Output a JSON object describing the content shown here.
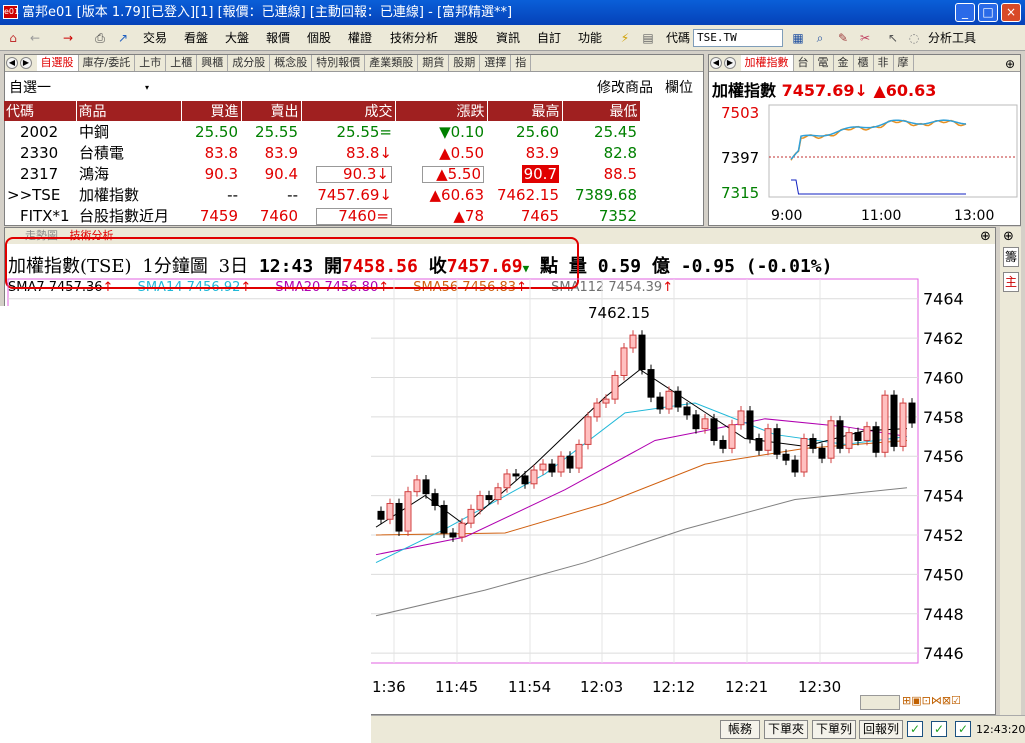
{
  "window": {
    "title": "富邦e01 [版本 1.79][已登入][1] [報價：已連線] [主動回報：已連線] - [富邦精選**]",
    "icon_text": "e01",
    "min": "_",
    "max": "□",
    "close": "×"
  },
  "toolbar": {
    "menus": [
      "交易",
      "看盤",
      "大盤",
      "報價",
      "個股",
      "權證",
      "技術分析",
      "選股",
      "資訊",
      "自訂",
      "功能"
    ],
    "code_label": "代碼",
    "code_value": "TSE.TW",
    "tools_label": "分析工具"
  },
  "watchlist": {
    "tabs": [
      "自選股",
      "庫存/委託",
      "上市",
      "上櫃",
      "興櫃",
      "成分股",
      "概念股",
      "特別報價",
      "產業類股",
      "期貨",
      "股期",
      "選擇",
      "指"
    ],
    "selector": "自選一",
    "modify": "修改商品",
    "column": "欄位",
    "headers": [
      "代碼",
      "商品",
      "買進",
      "賣出",
      "成交",
      "漲跌",
      "最高",
      "最低"
    ],
    "rows": [
      {
        "code": "2002",
        "name": "中鋼",
        "bid": "25.50",
        "ask": "25.55",
        "last": "25.55=",
        "change": "▼0.10",
        "high": "25.60",
        "low": "25.45"
      },
      {
        "code": "2330",
        "name": "台積電",
        "bid": "83.8",
        "ask": "83.9",
        "last": "83.8↓",
        "change": "▲0.50",
        "high": "83.9",
        "low": "82.8"
      },
      {
        "code": "2317",
        "name": "鴻海",
        "bid": "90.3",
        "ask": "90.4",
        "last": "90.3↓",
        "change": "▲5.50",
        "high": "90.7",
        "low": "88.5"
      },
      {
        "code": ">>TSE",
        "name": "加權指數",
        "bid": "--",
        "ask": "--",
        "last": "7457.69↓",
        "change": "▲60.63",
        "high": "7462.15",
        "low": "7389.68"
      },
      {
        "code": "FITX*1",
        "name": "台股指數近月",
        "bid": "7459",
        "ask": "7460",
        "last": "7460=",
        "change": "▲78",
        "high": "7465",
        "low": "7352"
      }
    ]
  },
  "mini_chart": {
    "tabs": [
      "加權指數",
      "台",
      "電",
      "金",
      "櫃",
      "非",
      "摩"
    ],
    "title": "加權指數",
    "price": "7457.69↓",
    "change": "▲60.63",
    "y_labels": [
      "7503",
      "7397",
      "7315"
    ],
    "x_labels": [
      "9:00",
      "11:00",
      "13:00"
    ]
  },
  "main_chart": {
    "tabs": [
      "走勢圖",
      "技術分析"
    ],
    "header": {
      "name": "加權指數(TSE)",
      "period": "1分鐘圖",
      "days": "3日",
      "time": "12:43",
      "open_label": "開",
      "open": "7458.56",
      "close_label": "收",
      "close": "7457.69",
      "unit": "點",
      "volume_label": "量",
      "volume": "0.59 億",
      "change": "-0.95 (-0.01%)"
    },
    "sma": [
      {
        "label": "SMA7 7457.36",
        "color": "#000000"
      },
      {
        "label": "SMA14 7456.92",
        "color": "#20b8d8"
      },
      {
        "label": "SMA20 7456.80",
        "color": "#b000b0"
      },
      {
        "label": "SMA56 7456.83",
        "color": "#d06010"
      },
      {
        "label": "SMA112 7454.39",
        "color": "#707070"
      }
    ],
    "high_annotation": "7462.15",
    "y_ticks": [
      "7464",
      "7462",
      "7460",
      "7458",
      "7456",
      "7454",
      "7452",
      "7450",
      "7448",
      "7446"
    ],
    "x_ticks": [
      "1:36",
      "11:45",
      "11:54",
      "12:03",
      "12:12",
      "12:21",
      "12:30"
    ]
  },
  "side_labels": [
    "籌",
    "主"
  ],
  "statusbar": {
    "buttons": [
      "帳務",
      "下單夾",
      "下單列",
      "回報列"
    ],
    "clock": "12:43:20"
  },
  "colors": {
    "up": "#e00000",
    "down": "#008000",
    "title_bg": "#0a5fd8",
    "header_bg": "#a02020"
  }
}
